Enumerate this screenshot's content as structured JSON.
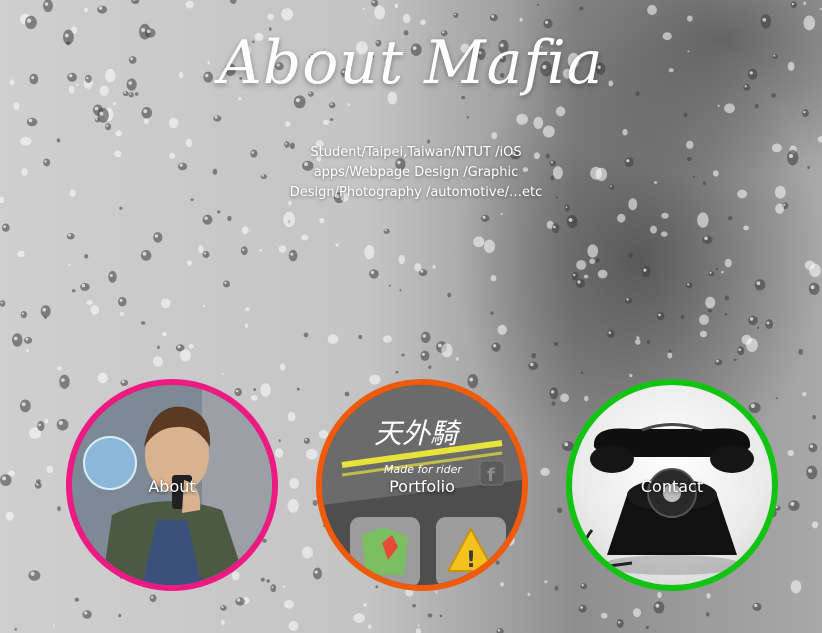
{
  "header": {
    "title": "About Mafia",
    "subtitle": "Student/Taipei,Taiwan/NTUT /iOS apps/Webpage Design /Graphic Design/Photography /automotive/…etc"
  },
  "nav": [
    {
      "label": "About",
      "ring_color": "#ee1a84"
    },
    {
      "label": "Portfolio",
      "ring_color": "#f05a0c"
    },
    {
      "label": "Contact",
      "ring_color": "#12c412"
    }
  ],
  "portfolio_preview": {
    "app_title": "天外騎",
    "tagline": "Made for rider"
  }
}
